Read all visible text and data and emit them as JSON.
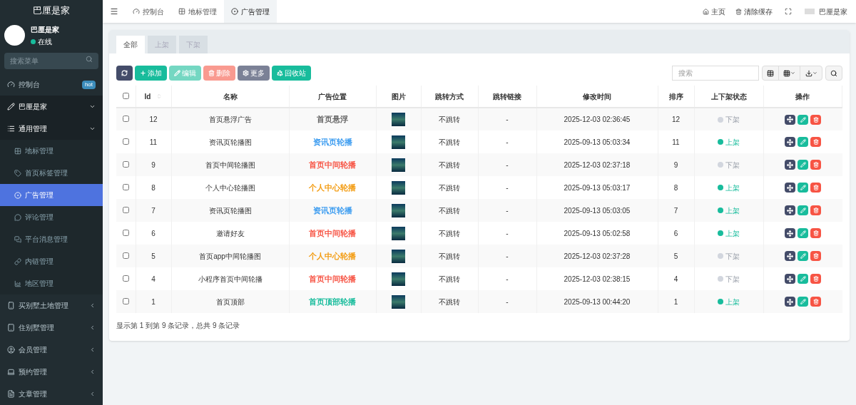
{
  "sidebar": {
    "logo": "巴厘是家",
    "user": {
      "name": "巴厘是家",
      "status": "在线",
      "online": true
    },
    "search": {
      "placeholder": "搜索菜单"
    },
    "items": [
      {
        "label": "控制台",
        "badge": "hot",
        "selected": false
      },
      {
        "label": "巴厘是家",
        "expanded": true,
        "selected": false
      },
      {
        "label": "通用管理",
        "expanded": true,
        "selected": false,
        "children": [
          {
            "label": "地标管理",
            "selected": false
          },
          {
            "label": "首页标签管理",
            "selected": false
          },
          {
            "label": "广告管理",
            "selected": true
          },
          {
            "label": "评论管理",
            "selected": false
          },
          {
            "label": "平台消息管理",
            "selected": false
          },
          {
            "label": "内链管理",
            "selected": false
          },
          {
            "label": "地区管理",
            "selected": false
          }
        ]
      },
      {
        "label": "买别墅土地管理",
        "expanded": false,
        "selected": false
      },
      {
        "label": "住别墅管理",
        "expanded": false,
        "selected": false
      },
      {
        "label": "会员管理",
        "expanded": false,
        "selected": false
      },
      {
        "label": "预约管理",
        "expanded": false,
        "selected": false
      },
      {
        "label": "文章管理",
        "expanded": false,
        "selected": false
      }
    ]
  },
  "topbar": {
    "tabs": [
      {
        "label": "控制台",
        "selected": false
      },
      {
        "label": "地标管理",
        "selected": false
      },
      {
        "label": "广告管理",
        "selected": true
      }
    ],
    "links": [
      "主页",
      "清除缓存"
    ],
    "user": "巴厘是家"
  },
  "filter_tabs": [
    {
      "label": "全部",
      "selected": true
    },
    {
      "label": "上架",
      "selected": false
    },
    {
      "label": "下架",
      "selected": false
    }
  ],
  "toolbar": [
    {
      "kind": "refresh"
    },
    {
      "kind": "add",
      "label": "添加",
      "disabled": false
    },
    {
      "kind": "edit",
      "label": "编辑",
      "disabled": true
    },
    {
      "kind": "delete",
      "label": "删除",
      "disabled": true
    },
    {
      "kind": "more",
      "label": "更多",
      "disabled": false
    },
    {
      "kind": "recycle",
      "label": "回收站",
      "disabled": false
    }
  ],
  "search": {
    "placeholder": "搜索"
  },
  "table": {
    "select_all_checked": false,
    "columns": [
      "Id",
      "名称",
      "广告位置",
      "图片",
      "跳转方式",
      "跳转链接",
      "修改时间",
      "排序",
      "上下架状态",
      "操作"
    ],
    "rows": [
      {
        "id": "12",
        "name": "首页悬浮广告",
        "position": "首页悬浮",
        "color": "#666666",
        "jump": "不跳转",
        "link": "-",
        "time": "2025-12-03 02:36:45",
        "sort": "12",
        "status": "下架",
        "on": false,
        "checked": false
      },
      {
        "id": "11",
        "name": "资讯页轮播图",
        "position": "资讯页轮播",
        "color": "#3c9cf0",
        "jump": "不跳转",
        "link": "-",
        "time": "2025-09-13 05:03:34",
        "sort": "11",
        "status": "上架",
        "on": true,
        "checked": false
      },
      {
        "id": "9",
        "name": "首页中间轮播图",
        "position": "首页中间轮播",
        "color": "#f75444",
        "jump": "不跳转",
        "link": "-",
        "time": "2025-12-03 02:37:18",
        "sort": "9",
        "status": "下架",
        "on": false,
        "checked": false
      },
      {
        "id": "8",
        "name": "个人中心轮播图",
        "position": "个人中心轮播",
        "color": "#f39c12",
        "jump": "不跳转",
        "link": "-",
        "time": "2025-09-13 05:03:17",
        "sort": "8",
        "status": "上架",
        "on": true,
        "checked": false
      },
      {
        "id": "7",
        "name": "资讯页轮播图",
        "position": "资讯页轮播",
        "color": "#3c9cf0",
        "jump": "不跳转",
        "link": "-",
        "time": "2025-09-13 05:03:05",
        "sort": "7",
        "status": "上架",
        "on": true,
        "checked": false
      },
      {
        "id": "6",
        "name": "邀请好友",
        "position": "首页中间轮播",
        "color": "#f75444",
        "jump": "不跳转",
        "link": "-",
        "time": "2025-09-13 05:02:58",
        "sort": "6",
        "status": "上架",
        "on": true,
        "checked": false
      },
      {
        "id": "5",
        "name": "首页app中间轮播图",
        "position": "个人中心轮播",
        "color": "#f39c12",
        "jump": "不跳转",
        "link": "-",
        "time": "2025-12-03 02:37:28",
        "sort": "5",
        "status": "下架",
        "on": false,
        "checked": false
      },
      {
        "id": "4",
        "name": "小程序首页中间轮播",
        "position": "首页中间轮播",
        "color": "#f75444",
        "jump": "不跳转",
        "link": "-",
        "time": "2025-12-03 02:38:15",
        "sort": "4",
        "status": "下架",
        "on": false,
        "checked": false
      },
      {
        "id": "1",
        "name": "首页顶部",
        "position": "首页顶部轮播",
        "color": "#18bc9c",
        "jump": "不跳转",
        "link": "-",
        "time": "2025-09-13 00:44:20",
        "sort": "1",
        "status": "上架",
        "on": true,
        "checked": false
      }
    ]
  },
  "pagination_info": "显示第 1 到第 9 条记录，总共 9 条记录"
}
